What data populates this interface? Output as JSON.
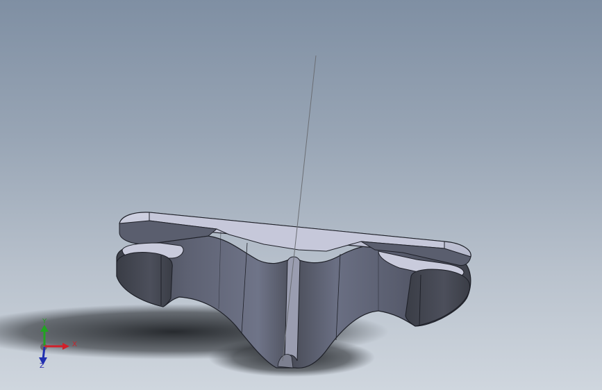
{
  "triad": {
    "x_label": "X",
    "y_label": "Y",
    "z_label": "Z",
    "x_color": "#d0202a",
    "y_color": "#22a322",
    "z_color": "#2030b0"
  },
  "model": {
    "face_light": "#c4c6da",
    "face_mid": "#6a6f82",
    "face_dark": "#41444f",
    "edge_color": "#1e2028"
  },
  "background": {
    "top": "#7f8fa3",
    "bottom": "#cfd6de"
  }
}
